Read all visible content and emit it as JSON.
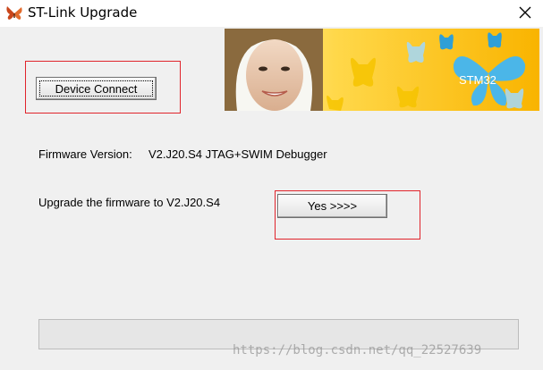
{
  "window": {
    "title": "ST-Link Upgrade",
    "close_glyph": "✕",
    "app_icon": "butterfly-icon"
  },
  "banner": {
    "logo_text": "STM32",
    "accent_color": "#f9b400"
  },
  "buttons": {
    "device_connect": "Device Connect",
    "yes": "Yes >>>>"
  },
  "info": {
    "firmware_label": "Firmware Version:",
    "firmware_value": "V2.J20.S4 JTAG+SWIM Debugger",
    "upgrade_text": "Upgrade the firmware to V2.J20.S4"
  },
  "progress": {
    "value": 0
  },
  "watermark": "https://blog.csdn.net/qq_22527639"
}
